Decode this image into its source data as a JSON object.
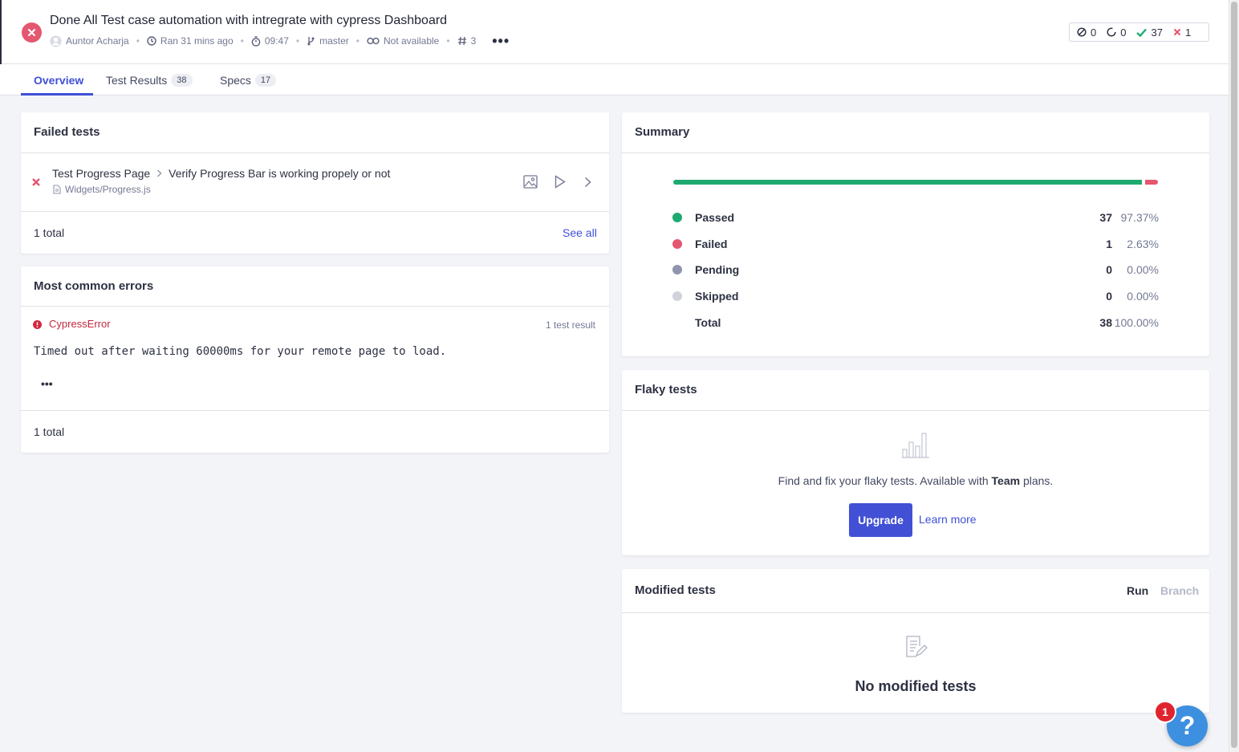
{
  "run": {
    "title": "Done All Test case automation with intregrate with cypress Dashboard",
    "author": "Auntor Acharja",
    "ran": "Ran 31 mins ago",
    "duration": "09:47",
    "branch": "master",
    "ci": "Not available",
    "run_number": "3",
    "more": "•••"
  },
  "counts": {
    "skipped": "0",
    "pending": "0",
    "passed": "37",
    "failed": "1"
  },
  "tabs": [
    {
      "label": "Overview"
    },
    {
      "label": "Test Results",
      "badge": "38"
    },
    {
      "label": "Specs",
      "badge": "17"
    }
  ],
  "failed_tests": {
    "title": "Failed tests",
    "item": {
      "suite": "Test Progress Page",
      "test": "Verify Progress Bar is working propely or not",
      "file": "Widgets/Progress.js"
    },
    "total": "1 total",
    "see_all": "See all"
  },
  "errors": {
    "title": "Most common errors",
    "type": "CypressError",
    "count": "1 test result",
    "message": "Timed out after waiting 60000ms for your remote page to load.",
    "more": "•••",
    "total": "1 total"
  },
  "summary": {
    "title": "Summary",
    "pass_fraction": 0.9737,
    "rows": [
      {
        "label": "Passed",
        "count": "37",
        "pct": "97.37%",
        "color": "#1fa971"
      },
      {
        "label": "Failed",
        "count": "1",
        "pct": "2.63%",
        "color": "#e45770"
      },
      {
        "label": "Pending",
        "count": "0",
        "pct": "0.00%",
        "color": "#9095ad"
      },
      {
        "label": "Skipped",
        "count": "0",
        "pct": "0.00%",
        "color": "#d0d2dc"
      },
      {
        "label": "Total",
        "count": "38",
        "pct": "100.00%",
        "color": ""
      }
    ]
  },
  "flaky": {
    "title": "Flaky tests",
    "text_pre": "Find and fix your flaky tests. Available with ",
    "text_bold": "Team",
    "text_post": " plans.",
    "upgrade": "Upgrade",
    "learn_more": "Learn more"
  },
  "modified": {
    "title": "Modified tests",
    "toggle_run": "Run",
    "toggle_branch": "Branch",
    "empty": "No modified tests"
  },
  "help": {
    "badge": "1",
    "icon": "?"
  },
  "colors": {
    "accent": "#4150d5",
    "passed": "#1fa971",
    "failed": "#e45770"
  }
}
